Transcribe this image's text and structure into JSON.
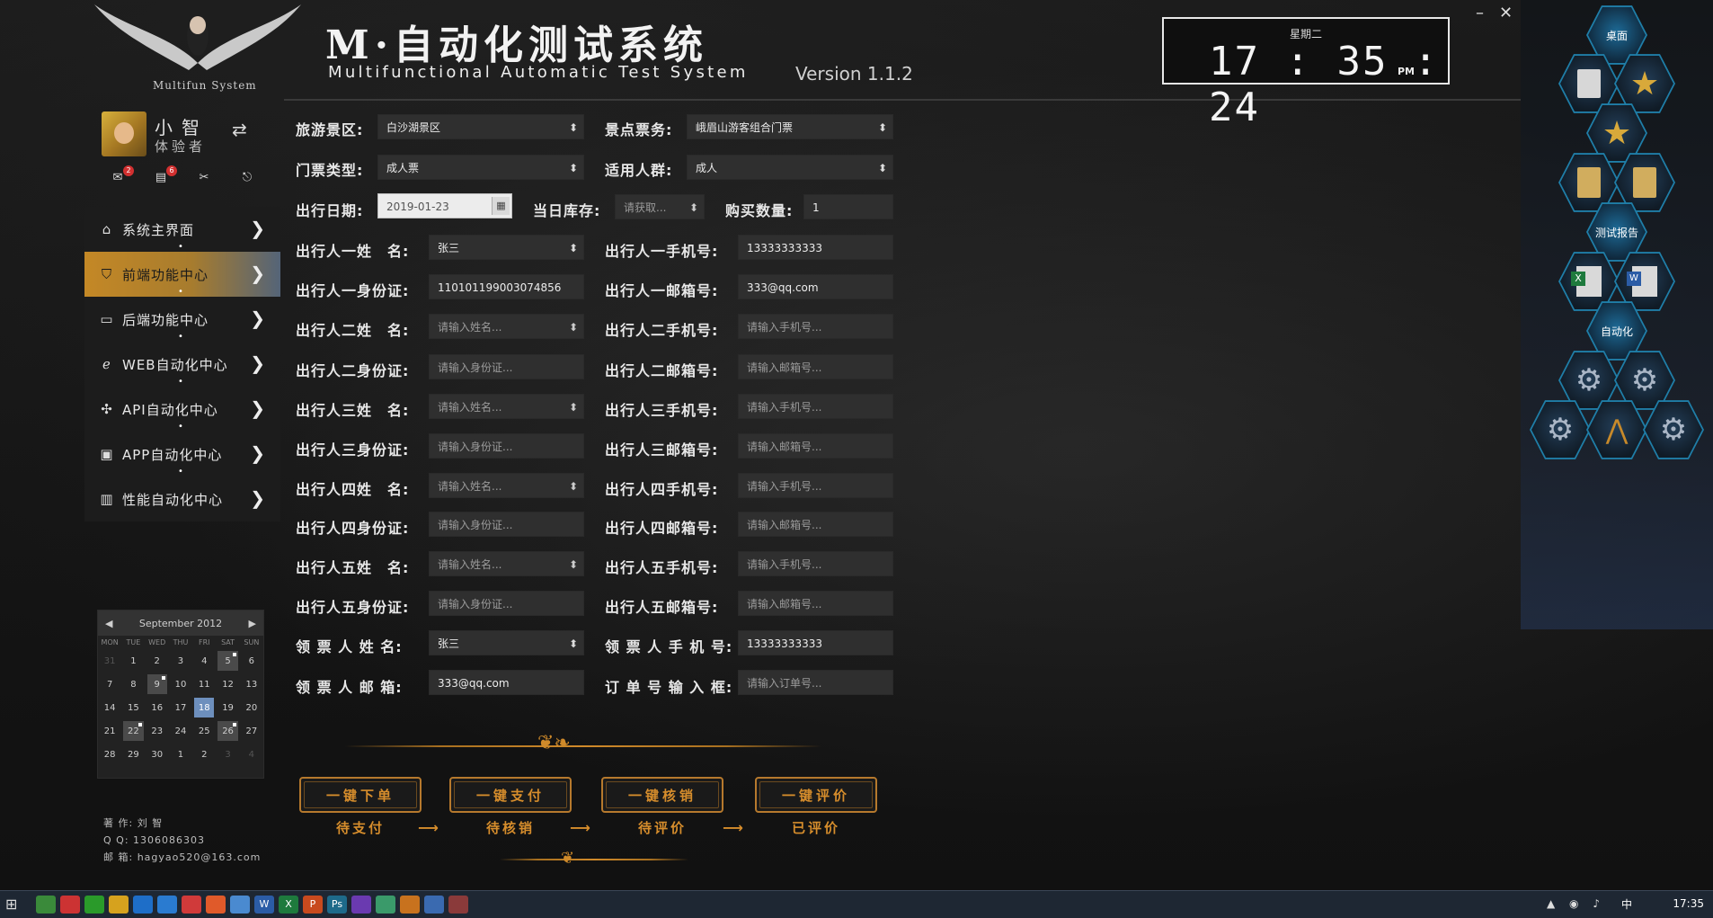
{
  "header": {
    "logo_sub": "Multifun System",
    "title": "M·自动化测试系统",
    "subtitle": "Multifunctional Automatic Test System",
    "version": "Version 1.1.2",
    "window_min": "–",
    "window_close": "✕"
  },
  "clock": {
    "weekday": "星期二",
    "time": "17 : 35 : 24",
    "ampm": "PM"
  },
  "user": {
    "name": "小智",
    "role": "体验者",
    "badges": {
      "inbox": "2",
      "tasks": "6"
    }
  },
  "nav": [
    {
      "label": "系统主界面",
      "icon": "home-icon"
    },
    {
      "label": "前端功能中心",
      "icon": "html5-icon",
      "active": true
    },
    {
      "label": "后端功能中心",
      "icon": "monitor-icon"
    },
    {
      "label": "WEB自动化中心",
      "icon": "ie-icon"
    },
    {
      "label": "API自动化中心",
      "icon": "api-icon"
    },
    {
      "label": "APP自动化中心",
      "icon": "app-icon"
    },
    {
      "label": "性能自动化中心",
      "icon": "chart-icon"
    }
  ],
  "calendar": {
    "month": "September 2012",
    "weekdays": [
      "MON",
      "TUE",
      "WED",
      "THU",
      "FRI",
      "SAT",
      "SUN"
    ],
    "days": [
      "31",
      "1",
      "2",
      "3",
      "4",
      "5",
      "6",
      "7",
      "8",
      "9",
      "10",
      "11",
      "12",
      "13",
      "14",
      "15",
      "16",
      "17",
      "18",
      "19",
      "20",
      "21",
      "22",
      "23",
      "24",
      "25",
      "26",
      "27",
      "28",
      "29",
      "30",
      "1",
      "2",
      "3",
      "4"
    ]
  },
  "author": {
    "name_label": "著 作: 刘 智",
    "qq_label": "Q Q: 1306086303",
    "email_label": "邮 箱: hagyao520@163.com"
  },
  "form": {
    "scenic_label": "旅游景区:",
    "scenic_value": "白沙湖景区",
    "ticket_service_label": "景点票务:",
    "ticket_service_value": "峨眉山游客组合门票",
    "ticket_type_label": "门票类型:",
    "ticket_type_value": "成人票",
    "crowd_label": "适用人群:",
    "crowd_value": "成人",
    "date_label": "出行日期:",
    "date_value": "2019-01-23",
    "stock_label": "当日库存:",
    "stock_value": "请获取...",
    "qty_label": "购买数量:",
    "qty_value": "1",
    "t1_name_label": "出行人一姓　名:",
    "t1_name_value": "张三",
    "t1_phone_label": "出行人一手机号:",
    "t1_phone_value": "13333333333",
    "t1_id_label": "出行人一身份证:",
    "t1_id_value": "110101199003074856",
    "t1_email_label": "出行人一邮箱号:",
    "t1_email_value": "333@qq.com",
    "t2_name_label": "出行人二姓　名:",
    "t2_phone_label": "出行人二手机号:",
    "t2_id_label": "出行人二身份证:",
    "t2_email_label": "出行人二邮箱号:",
    "t3_name_label": "出行人三姓　名:",
    "t3_phone_label": "出行人三手机号:",
    "t3_id_label": "出行人三身份证:",
    "t3_email_label": "出行人三邮箱号:",
    "t4_name_label": "出行人四姓　名:",
    "t4_phone_label": "出行人四手机号:",
    "t4_id_label": "出行人四身份证:",
    "t4_email_label": "出行人四邮箱号:",
    "t5_name_label": "出行人五姓　名:",
    "t5_phone_label": "出行人五手机号:",
    "t5_id_label": "出行人五身份证:",
    "t5_email_label": "出行人五邮箱号:",
    "ph_name": "请输入姓名...",
    "ph_phone": "请输入手机号...",
    "ph_id": "请输入身份证...",
    "ph_email": "请输入邮箱号...",
    "receiver_name_label": "领 票 人 姓 名:",
    "receiver_name_value": "张三",
    "receiver_phone_label": "领 票 人 手 机 号:",
    "receiver_phone_value": "13333333333",
    "receiver_email_label": "领 票 人 邮 箱:",
    "receiver_email_value": "333@qq.com",
    "order_label": "订 单 号 输 入 框:",
    "order_placeholder": "请输入订单号..."
  },
  "actions": [
    {
      "button": "一键下单",
      "stage": "待支付"
    },
    {
      "button": "一键支付",
      "stage": "待核销"
    },
    {
      "button": "一键核销",
      "stage": "待评价"
    },
    {
      "button": "一键评价",
      "stage": "已评价"
    }
  ],
  "hex_menu": {
    "desktop": "桌面",
    "report": "测试报告",
    "automation": "自动化"
  },
  "taskbar": {
    "time": "17:35",
    "ime": "中"
  },
  "colors": {
    "accent": "#d68d2c",
    "hex_border": "#1f7ea8",
    "active_nav": "#c48826"
  }
}
